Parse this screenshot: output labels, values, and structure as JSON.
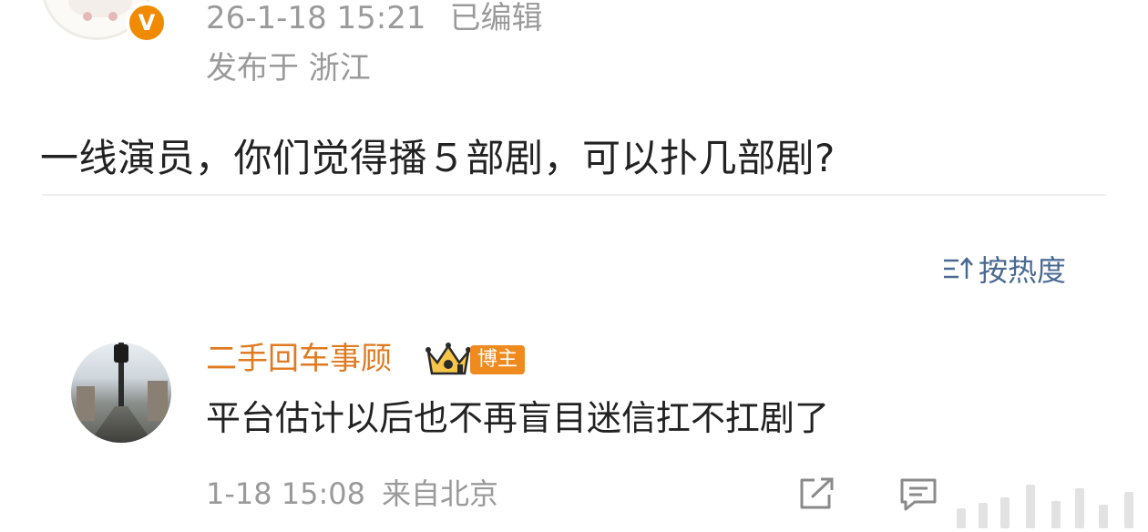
{
  "post": {
    "time": "26-1-18 15:21",
    "edited": "已编辑",
    "location": "发布于 浙江",
    "title": "一线演员，你们觉得播５部剧，可以扑几部剧?"
  },
  "badges": {
    "verified_letter": "V",
    "blogger": "博主"
  },
  "sort": {
    "label": "按热度"
  },
  "comment": {
    "author": "二手回车事顾",
    "text": "平台估计以后也不再盲目迷信扛不扛剧了",
    "time": "1-18 15:08",
    "source": "来自北京"
  },
  "colors": {
    "author": "#e07a1f",
    "link": "#4b6a92",
    "meta": "#9a9a9a",
    "badge": "#ef8a1f"
  },
  "icons": [
    "verified-icon",
    "sort-icon",
    "crown-icon",
    "share-icon",
    "reply-icon"
  ]
}
